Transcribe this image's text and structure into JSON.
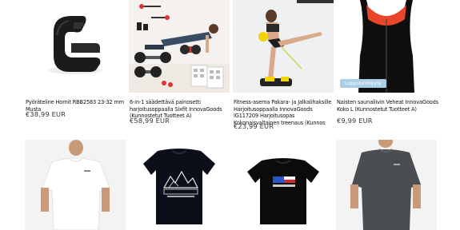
{
  "products": [
    {
      "title": "Pyöräteline Hornit RBB2583 23-32 mm Musta",
      "price": "€38,99 EUR"
    },
    {
      "title": "6-in-1 säädettävä painosetti harjoitusoppaalla Sixfit InnovaGoods (Kunnostetut Tuotteet A)",
      "price": "€58,99 EUR"
    },
    {
      "title": "Fitness-asema Pakara- ja Jalkalihaksille Harjoitusoppaalla InnovaGoods IG117209 Harjoitusopas Kokonaisvaltainen treenaus (Kunnos",
      "price": "€23,99 EUR"
    },
    {
      "title": "Naisten saunaliivin Veheat InnovaGoods Koko L (Kunnostetut Tuotteet A)",
      "price": "€9,99 EUR",
      "badge": "Loppuunmyyty"
    },
    {
      "title": "",
      "price": ""
    },
    {
      "title": "",
      "price": ""
    },
    {
      "title": "",
      "price": ""
    },
    {
      "title": "",
      "price": ""
    }
  ],
  "colors": {
    "badge": "#a9cfe6",
    "accent_red": "#e8462b"
  }
}
